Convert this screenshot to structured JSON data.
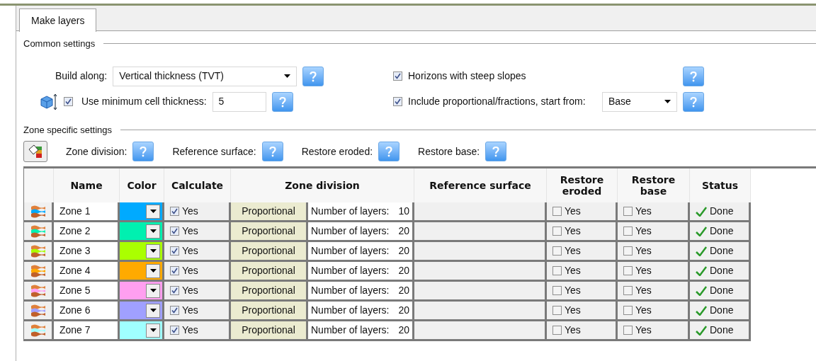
{
  "tabs": [
    {
      "label": "Make layers",
      "selected": true
    }
  ],
  "common": {
    "title": "Common settings",
    "build_along_label": "Build along:",
    "build_along_value": "Vertical thickness (TVT)",
    "min_thickness": {
      "label": "Use minimum cell thickness:",
      "checked": true,
      "value": "5"
    },
    "steep_slopes": {
      "label": "Horizons with steep slopes",
      "checked": true
    },
    "proportional": {
      "label": "Include proportional/fractions, start from:",
      "checked": true,
      "value": "Base"
    }
  },
  "zone": {
    "title": "Zone specific settings",
    "help_labels": [
      "Zone division:",
      "Reference surface:",
      "Restore eroded:",
      "Restore base:"
    ]
  },
  "table": {
    "columns": [
      "Name",
      "Color",
      "Calculate",
      "Zone division",
      "Reference surface",
      "Restore eroded",
      "Restore base",
      "Status"
    ],
    "rows": [
      {
        "name": "Zone 1",
        "color": "#00aaff",
        "calculate": true,
        "calc_label": "Yes",
        "method": "Proportional",
        "layers_label": "Number of layers:",
        "layers": "10",
        "restore_eroded": false,
        "eroded_label": "Yes",
        "restore_base": false,
        "base_label": "Yes",
        "status": "Done"
      },
      {
        "name": "Zone 2",
        "color": "#00f0b0",
        "calculate": true,
        "calc_label": "Yes",
        "method": "Proportional",
        "layers_label": "Number of layers:",
        "layers": "20",
        "restore_eroded": false,
        "eroded_label": "Yes",
        "restore_base": false,
        "base_label": "Yes",
        "status": "Done"
      },
      {
        "name": "Zone 3",
        "color": "#aaff00",
        "calculate": true,
        "calc_label": "Yes",
        "method": "Proportional",
        "layers_label": "Number of layers:",
        "layers": "20",
        "restore_eroded": false,
        "eroded_label": "Yes",
        "restore_base": false,
        "base_label": "Yes",
        "status": "Done"
      },
      {
        "name": "Zone 4",
        "color": "#ffaa00",
        "calculate": true,
        "calc_label": "Yes",
        "method": "Proportional",
        "layers_label": "Number of layers:",
        "layers": "20",
        "restore_eroded": false,
        "eroded_label": "Yes",
        "restore_base": false,
        "base_label": "Yes",
        "status": "Done"
      },
      {
        "name": "Zone 5",
        "color": "#ff9ff0",
        "calculate": true,
        "calc_label": "Yes",
        "method": "Proportional",
        "layers_label": "Number of layers:",
        "layers": "20",
        "restore_eroded": false,
        "eroded_label": "Yes",
        "restore_base": false,
        "base_label": "Yes",
        "status": "Done"
      },
      {
        "name": "Zone 6",
        "color": "#a0a0ff",
        "calculate": true,
        "calc_label": "Yes",
        "method": "Proportional",
        "layers_label": "Number of layers:",
        "layers": "20",
        "restore_eroded": false,
        "eroded_label": "Yes",
        "restore_base": false,
        "base_label": "Yes",
        "status": "Done"
      },
      {
        "name": "Zone 7",
        "color": "#a0ffff",
        "calculate": true,
        "calc_label": "Yes",
        "method": "Proportional",
        "layers_label": "Number of layers:",
        "layers": "20",
        "restore_eroded": false,
        "eroded_label": "Yes",
        "restore_base": false,
        "base_label": "Yes",
        "status": "Done"
      }
    ]
  }
}
